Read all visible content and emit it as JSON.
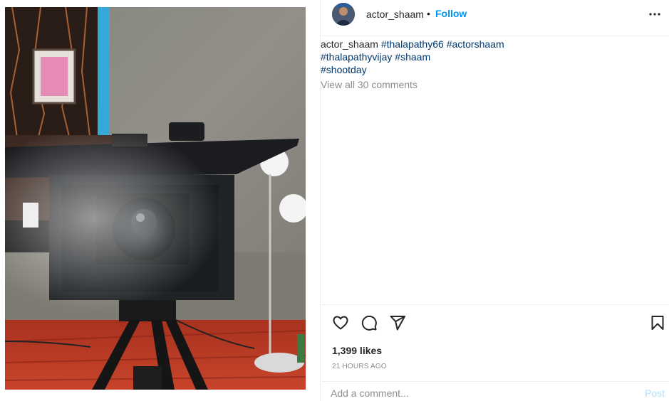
{
  "post": {
    "username": "actor_shaam",
    "separator": "•",
    "follow_label": "Follow",
    "more_icon": "more-horizontal-icon",
    "caption_user": "actor_shaam",
    "hashtags": [
      "#thalapathy66",
      "#actorshaam",
      "#thalapathyvijay",
      "#shaam",
      "#shootday"
    ],
    "view_comments": "View all 30 comments",
    "likes": "1,399 likes",
    "timestamp": "21 HOURS AGO",
    "comment_placeholder": "Add a comment...",
    "post_label": "Post"
  },
  "icons": {
    "like": "heart-icon",
    "comment": "comment-icon",
    "share": "send-icon",
    "save": "bookmark-icon"
  },
  "colors": {
    "follow": "#0095f6",
    "hashtag": "#00376b",
    "muted": "#8e8e8e",
    "post_disabled": "#b2dffc"
  }
}
